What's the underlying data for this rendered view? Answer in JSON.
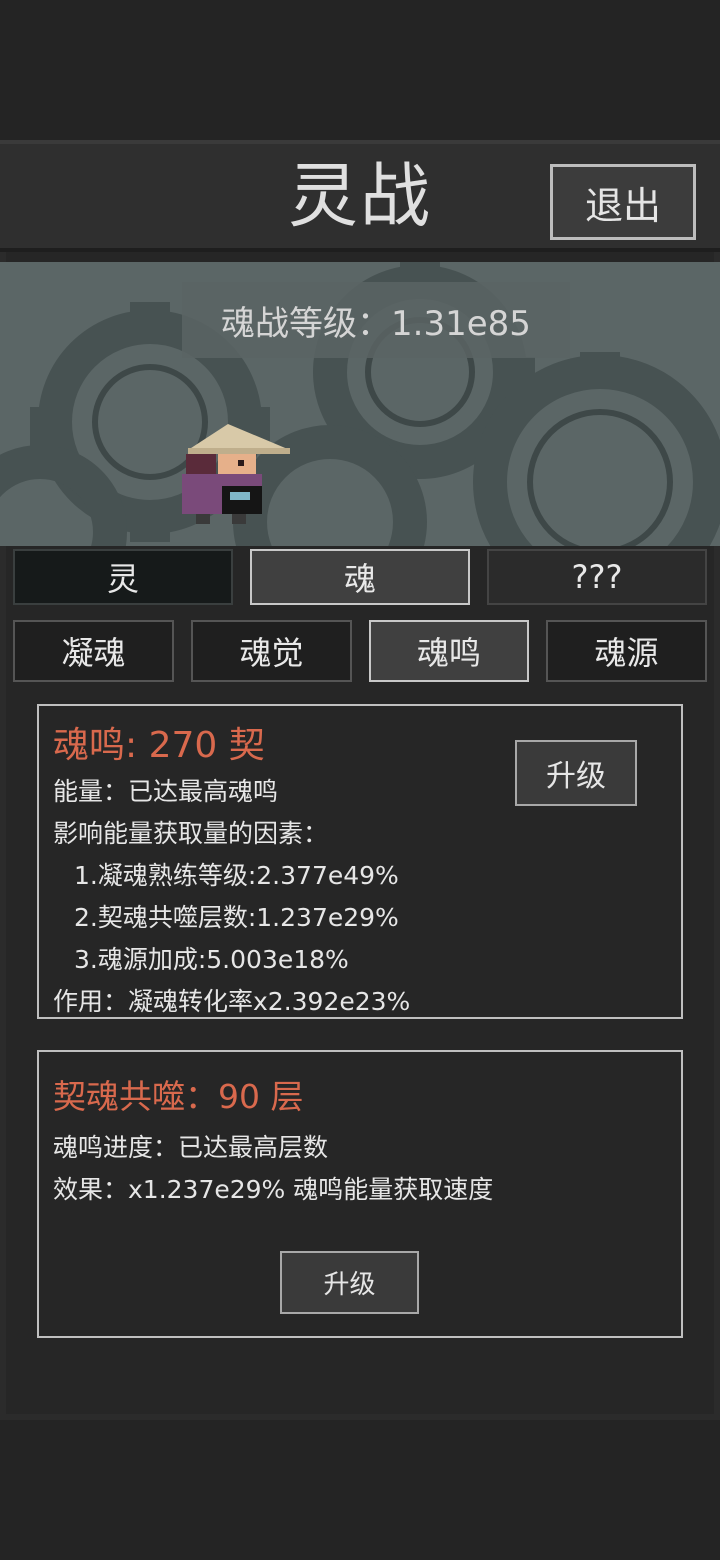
{
  "header": {
    "title": "灵战",
    "exit_label": "退出"
  },
  "scene": {
    "level_text": "魂战等级：1.31e85"
  },
  "main_tabs": [
    {
      "label": "灵",
      "state": "normal"
    },
    {
      "label": "魂",
      "state": "active"
    },
    {
      "label": "???",
      "state": "locked"
    }
  ],
  "sub_tabs": [
    {
      "label": "凝魂",
      "state": "normal"
    },
    {
      "label": "魂觉",
      "state": "normal"
    },
    {
      "label": "魂鸣",
      "state": "active"
    },
    {
      "label": "魂源",
      "state": "normal"
    }
  ],
  "resonance_card": {
    "title": "魂鸣: 270 契",
    "upgrade_label": "升级",
    "energy": "能量：已达最高魂鸣",
    "factors_title": "影响能量获取量的因素：",
    "factors": [
      "1.凝魂熟练等级:2.377e49%",
      "2.契魂共噬层数:1.237e29%",
      "3.魂源加成:5.003e18%"
    ],
    "effect": "作用：凝魂转化率x2.392e23%"
  },
  "devour_card": {
    "title": "契魂共噬：90 层",
    "progress": "魂鸣进度：已达最高层数",
    "effect": "效果：x1.237e29% 魂鸣能量获取速度",
    "upgrade_label": "升级"
  },
  "colors": {
    "accent": "#d9694d",
    "background": "#242424",
    "scene": "#5b6666"
  }
}
